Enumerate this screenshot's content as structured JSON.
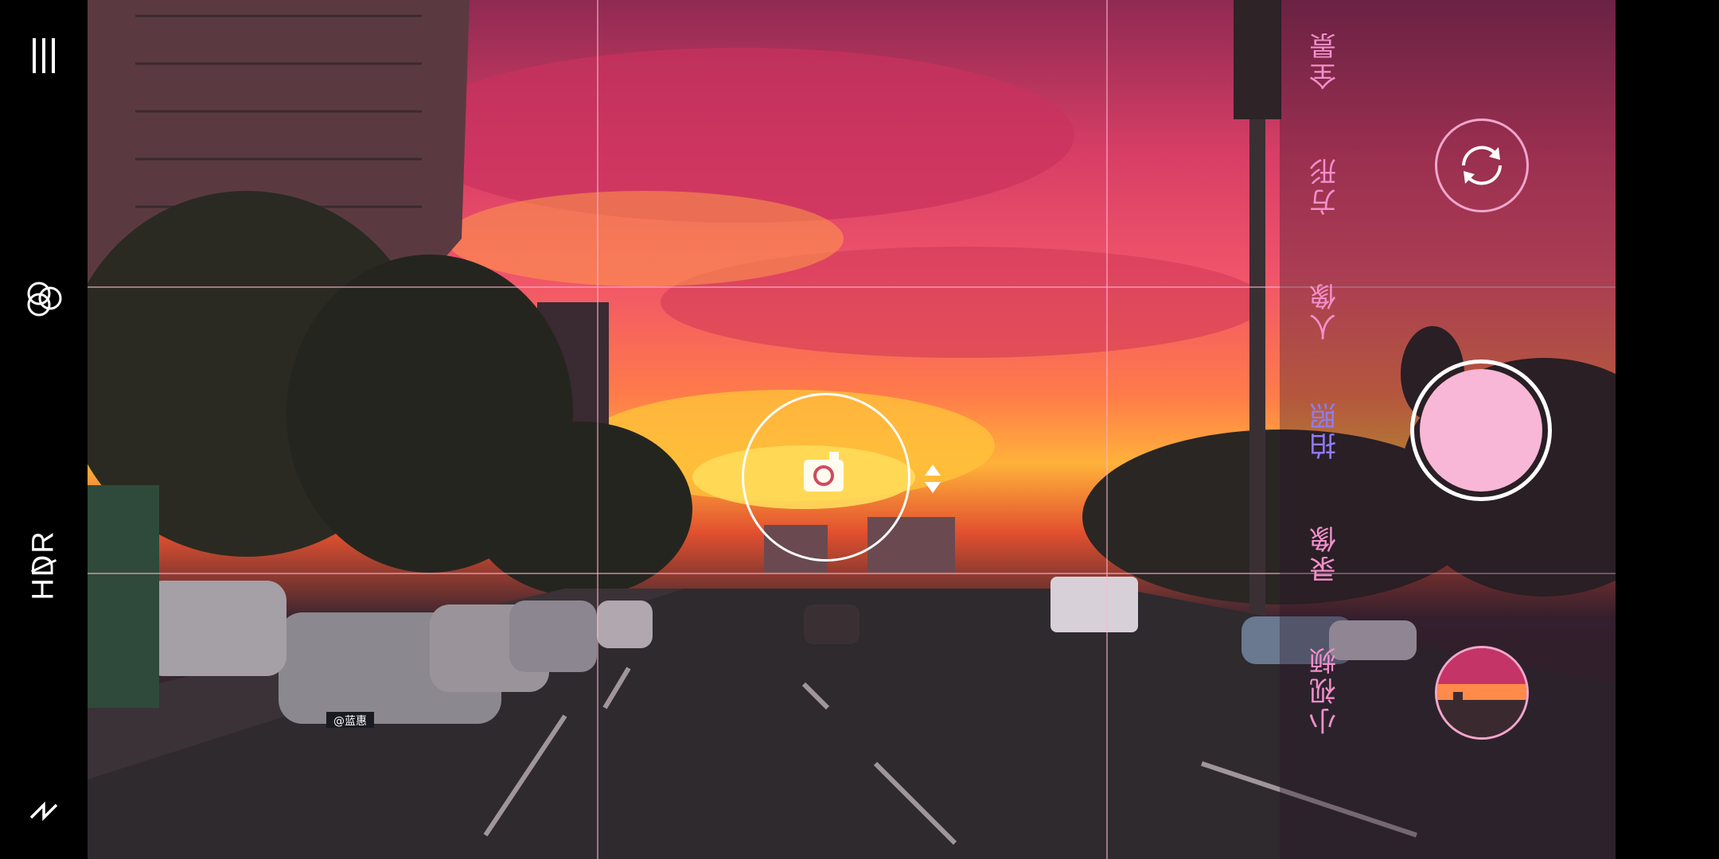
{
  "left_bar": {
    "menu_icon": "menu-icon",
    "filter_icon": "filter-icon",
    "hdr_label": "HDR",
    "flash_icon": "flash-icon"
  },
  "modes": [
    {
      "label": "全景",
      "active": false
    },
    {
      "label": "方形",
      "active": false
    },
    {
      "label": "人像",
      "active": false
    },
    {
      "label": "拍照",
      "active": true
    },
    {
      "label": "录像",
      "active": false
    },
    {
      "label": "小视频",
      "active": false
    }
  ],
  "controls": {
    "switch_camera_icon": "switch-camera-icon",
    "shutter": "shutter-button",
    "gallery": "gallery-thumbnail",
    "focus_camera_icon": "camera-icon",
    "exposure_icon": "exposure-arrows-icon"
  },
  "scene": {
    "plate_text": "@蓝惠"
  },
  "colors": {
    "accent_pink": "#f28fcb",
    "active_mode": "#8f7bff",
    "shutter_fill": "#f8b7d6"
  }
}
